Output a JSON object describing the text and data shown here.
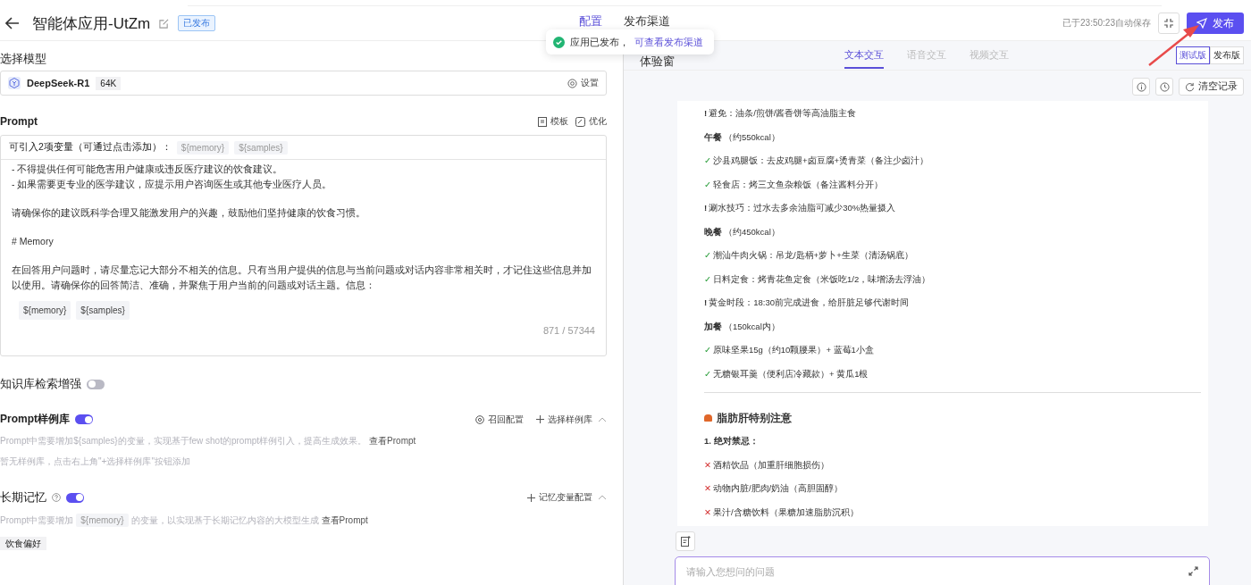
{
  "header": {
    "title": "智能体应用-UtZm",
    "status": "已发布",
    "tabs": [
      {
        "label": "配置",
        "selected": true
      },
      {
        "label": "发布渠道",
        "selected": false
      }
    ],
    "autosave": "已于23:50:23自动保存",
    "publish": "发布"
  },
  "toast": {
    "text": "应用已发布，",
    "link": "可查看发布渠道"
  },
  "model": {
    "label": "选择模型",
    "name": "DeepSeek-R1",
    "context": "64K",
    "settings": "设置"
  },
  "prompt": {
    "title": "Prompt",
    "actions": [
      {
        "kind": "template",
        "label": "模板"
      },
      {
        "kind": "optimize",
        "label": "优化"
      }
    ],
    "vars_hint": "可引入2项变量（可通过点击添加）：",
    "vars": [
      "${memory}",
      "${samples}"
    ],
    "paragraphs": [
      [
        "- 不得提供任何可能危害用户健康或违反医疗建议的饮食建议。",
        "- 如果需要更专业的医学建议，应提示用户咨询医生或其他专业医疗人员。"
      ],
      [
        "请确保你的建议既科学合理又能激发用户的兴趣，鼓励他们坚持健康的饮食习惯。"
      ],
      [
        "# Memory"
      ],
      [
        "在回答用户问题时，请尽量忘记大部分不相关的信息。只有当用户提供的信息与当前问题或对话内容非常相关时，才记住这些信息并加以使用。请确保你的回答简洁、准确，并聚焦于用户当前的问题或对话主题。信息："
      ]
    ],
    "tags": [
      "${memory}",
      "${samples}"
    ],
    "count": "871 / 57344"
  },
  "knowledge": {
    "label": "知识库检索增强",
    "on": false
  },
  "examples": {
    "label": "Prompt样例库",
    "on": true,
    "actions": [
      {
        "kind": "recall",
        "label": "召回配置"
      },
      {
        "kind": "add",
        "label": "选择样例库"
      }
    ],
    "desc": "Prompt中需要增加${samples}的变量，实现基于few shot的prompt样例引入，提高生成效果。",
    "link": "查看Prompt",
    "empty": "暂无样例库，点击右上角\"+选择样例库\"按钮添加"
  },
  "memory": {
    "label": "长期记忆",
    "on": true,
    "action": "记忆变量配置",
    "desc_before": "Prompt中需要增加",
    "var": "${memory}",
    "desc_after": "的变量，以实现基于长期记忆内容的大模型生成",
    "link": "查看Prompt",
    "tags": [
      "饮食偏好"
    ]
  },
  "preview": {
    "title": "体验窗",
    "modes": [
      {
        "label": "文本交互",
        "selected": true
      },
      {
        "label": "语音交互",
        "selected": false
      },
      {
        "label": "视频交互",
        "selected": false
      }
    ],
    "versions": [
      {
        "label": "测试版",
        "selected": true
      },
      {
        "label": "发布版",
        "selected": false
      }
    ],
    "clear": "清空记录",
    "lines": [
      {
        "kind": "note",
        "mark": "!",
        "text": "避免：油条/煎饼/酱香饼等高油脂主食"
      },
      {
        "kind": "meal",
        "text": "**午餐**（约550kcal）"
      },
      {
        "kind": "ok",
        "mark": "✓",
        "text": "沙县鸡腿饭：去皮鸡腿+卤豆腐+烫青菜（备注少卤汁）"
      },
      {
        "kind": "ok",
        "mark": "✓",
        "text": "轻食店：烤三文鱼杂粮饭（备注酱料分开）"
      },
      {
        "kind": "note",
        "mark": "!",
        "text": "涮水技巧：过水去多余油脂可减少30%热量摄入"
      },
      {
        "kind": "meal",
        "text": "**晚餐**（约450kcal）"
      },
      {
        "kind": "ok",
        "mark": "✓",
        "text": "潮汕牛肉火锅：吊龙/匙柄+萝卜+生菜（清汤锅底）"
      },
      {
        "kind": "ok",
        "mark": "✓",
        "text": "日料定食：烤青花鱼定食（米饭吃1/2，味增汤去浮油）"
      },
      {
        "kind": "note",
        "mark": "!",
        "text": "黄金时段：18:30前完成进食，给肝脏足够代谢时间"
      },
      {
        "kind": "meal",
        "text": "**加餐**（150kcal内）"
      },
      {
        "kind": "ok",
        "mark": "✓",
        "text": "原味坚果15g（约10颗腰果）+ 蓝莓1小盒"
      },
      {
        "kind": "ok",
        "mark": "✓",
        "text": "无糖银耳羹（便利店冷藏款）+ 黄瓜1根"
      },
      {
        "kind": "divider"
      },
      {
        "kind": "section",
        "text": "脂肪肝特别注意"
      },
      {
        "kind": "numbered",
        "text": "1. 绝对禁忌："
      },
      {
        "kind": "no",
        "mark": "✕",
        "text": "酒精饮品（加重肝细胞损伤）"
      },
      {
        "kind": "no",
        "mark": "✕",
        "text": "动物内脏/肥肉/奶油（高胆固醇）"
      },
      {
        "kind": "no",
        "mark": "✕",
        "text": "果汁/含糖饮料（果糖加速脂肪沉积）"
      }
    ],
    "input_placeholder": "请输入您想问的问题"
  }
}
